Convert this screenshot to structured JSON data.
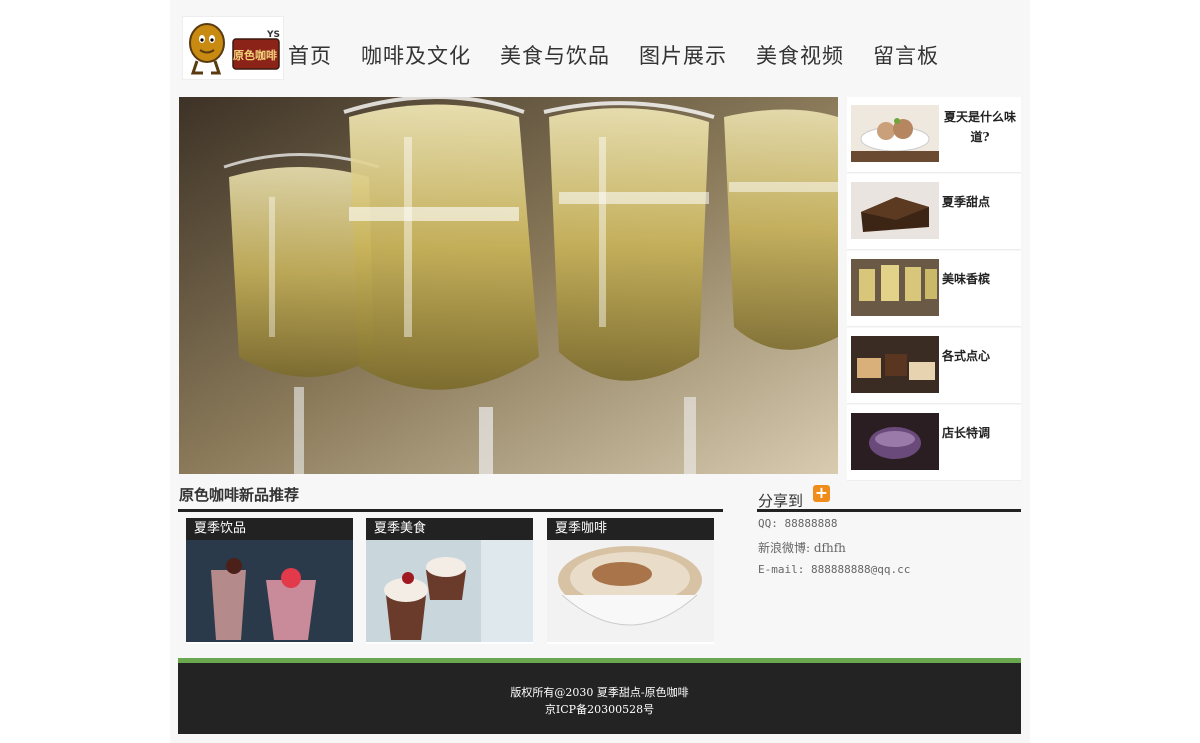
{
  "header": {
    "nav": [
      "首页",
      "咖啡及文化",
      "美食与饮品",
      "图片展示",
      "美食视频",
      "留言板"
    ],
    "logo_text": "原色咖啡"
  },
  "side": {
    "items": [
      {
        "title": "夏天是什么味道?"
      },
      {
        "title": "夏季甜点"
      },
      {
        "title": "美味香槟"
      },
      {
        "title": "各式点心"
      },
      {
        "title": "店长特调"
      }
    ]
  },
  "products": {
    "heading": "原色咖啡新品推荐",
    "cards": [
      {
        "label": "夏季饮品"
      },
      {
        "label": "夏季美食"
      },
      {
        "label": "夏季咖啡"
      }
    ]
  },
  "share": {
    "heading": "分享到",
    "qq": "QQ: 88888888",
    "weibo": "新浪微博: dfhfh",
    "email": "E-mail: 888888888@qq.cc"
  },
  "footer": {
    "copyright": "版权所有@2030 夏季甜点-原色咖啡",
    "icp": "京ICP备20300528号"
  },
  "colors": {
    "footer_bg": "#232323",
    "footer_accent": "#6aa84f",
    "share_icon": "#f08c1a"
  }
}
